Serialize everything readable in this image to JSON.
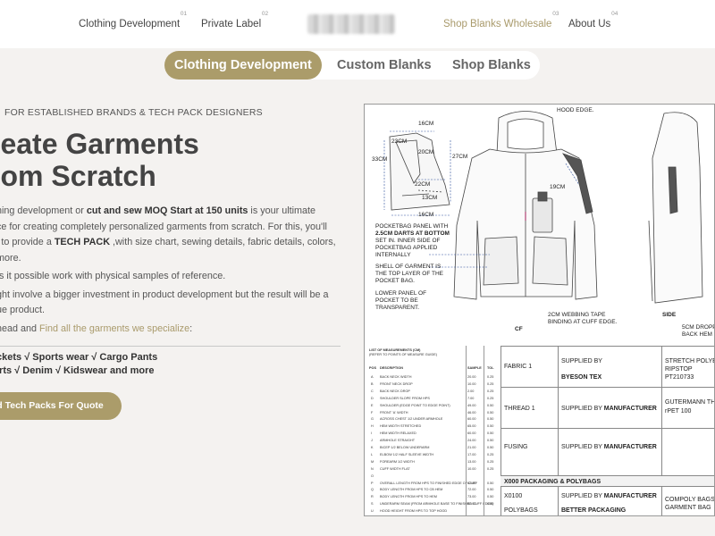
{
  "nav": {
    "items": [
      {
        "label": "Clothing Development",
        "num": "01"
      },
      {
        "label": "Private Label",
        "num": "02"
      },
      {
        "label": "Shop Blanks Wholesale",
        "num": "03"
      },
      {
        "label": "About Us",
        "num": "04"
      }
    ]
  },
  "tabs": [
    "Clothing Development",
    "Custom Blanks",
    "Shop Blanks"
  ],
  "hero": {
    "eyebrow": "FOR ESTABLISHED BRANDS & TECH PACK DESIGNERS",
    "headline_1": "reate Garments",
    "headline_2": "rom Scratch",
    "para1_a": "hing development or ",
    "para1_b": "cut and sew MOQ Start at 150 units",
    "para1_c": " is your ultimate",
    "para1_d": "ce for creating completely personalized garments from scratch. For this, you'll",
    "para1_e": "l to provide a ",
    "para1_f": "TECH PACK",
    "para1_g": " ,with size chart, sewing details, fabric details, colors,",
    "para1_h": "more.",
    "para2": "Is it possible work with physical samples of reference.",
    "para3_a": "ght involve a bigger investment in product development but the result will be a",
    "para3_b": "ue product.",
    "lead_a": "head and ",
    "lead_link": "Find all the garments we specialize",
    "lead_b": ":",
    "garments_1": "ckets √ Sports wear √ Cargo Pants",
    "garments_2": "irts  √ Denim  √ Kidswear and more",
    "cta": "d Tech Packs For Quote"
  },
  "techpack": {
    "dims": [
      "16CM",
      "23CM",
      "20CM",
      "33CM",
      "27CM",
      "22CM",
      "13CM",
      "16CM",
      "19CM"
    ],
    "hood_note": "HOOD EDGE.",
    "pocket_note": [
      "POCKETBAG PANEL WITH",
      "2.5CM DARTS AT BOTTOM",
      "SET IN. INNER SIDE OF",
      "POCKETBAG APPLIED",
      "INTERNALLY"
    ],
    "shell_note": [
      "SHELL OF GARMENT IS",
      "THE TOP LAYER OF THE",
      "POCKET BAG."
    ],
    "lower_note": [
      "LOWER PANEL OF",
      "POCKET TO BE",
      "TRANSPARENT."
    ],
    "webbing_note": [
      "2CM WEBBING TAPE",
      "BINDING AT CUFF EDGE."
    ],
    "cf_label": "CF",
    "side_label": "SIDE",
    "hem_note": [
      "5CM DROPPED",
      "BACK HEM"
    ],
    "meas_title": "LIST OF MEASUREMENTS (CM)",
    "meas_sub": "(REFER TO POINTS OF MEASURE GUIDE)",
    "meas_cols": [
      "POS",
      "DESCRIPTION",
      "SAMPLE",
      "TOL"
    ],
    "meas_rows": [
      {
        "k": "A",
        "d": "BACK NECK WIDTH",
        "v": "20.00",
        "t": "0.25"
      },
      {
        "k": "B",
        "d": "FRONT NECK DROP",
        "v": "10.00",
        "t": "0.25"
      },
      {
        "k": "C",
        "d": "BACK NECK DROP",
        "v": "2.00",
        "t": "0.25"
      },
      {
        "k": "D",
        "d": "SHOULDER SLOPE FROM HPS",
        "v": "7.00",
        "t": "0.25"
      },
      {
        "k": "E",
        "d": "SHOULDER (EDGE POINT TO EDGE POINT)",
        "v": "49.00",
        "t": "0.50"
      },
      {
        "k": "F",
        "d": "FRONT 'A' WIDTH",
        "v": "46.00",
        "t": "0.50"
      },
      {
        "k": "G",
        "d": "ACROSS CHEST 1/2 UNDER ARMHOLE",
        "v": "60.00",
        "t": "0.50"
      },
      {
        "k": "H",
        "d": "HEM WIDTH STRETCHED",
        "v": "65.00",
        "t": "0.50"
      },
      {
        "k": "I",
        "d": "HEM WIDTH RELAXED",
        "v": "60.00",
        "t": "0.50"
      },
      {
        "k": "J",
        "d": "ARMHOLE STRAIGHT",
        "v": "24.00",
        "t": "0.50"
      },
      {
        "k": "K",
        "d": "BICEP 1/2 BELOW UNDERARM",
        "v": "21.00",
        "t": "0.50"
      },
      {
        "k": "L",
        "d": "ELBOW 1/2 HALF SLEEVE WIDTH",
        "v": "17.00",
        "t": "0.25"
      },
      {
        "k": "M",
        "d": "FOREARM 1/2 WIDTH",
        "v": "13.00",
        "t": "0.25"
      },
      {
        "k": "N",
        "d": "CUFF WIDTH FLAT",
        "v": "10.00",
        "t": "0.25"
      },
      {
        "k": "O",
        "d": "",
        "v": "",
        "t": ""
      },
      {
        "k": "P",
        "d": "OVERALL LENGTH FROM HPS TO FINISHED EDGE OF CUFF",
        "v": "82.00",
        "t": "0.50"
      },
      {
        "k": "Q",
        "d": "BODY LENGTH FROM HPS TO CB HEM",
        "v": "72.00",
        "t": "0.50"
      },
      {
        "k": "R",
        "d": "BODY LENGTH FROM HPS TO HEM",
        "v": "73.00",
        "t": "0.50"
      },
      {
        "k": "S",
        "d": "UNDERARM SEAM (FROM ARMHOLE BASE TO FINISHED CUFF EDGE)",
        "v": "52.00",
        "t": "0.50"
      },
      {
        "k": "U",
        "d": "HOOD HEIGHT FROM HPS TO TOP HOOD",
        "v": "",
        "t": ""
      }
    ],
    "fabric_rows": [
      {
        "a": "FABRIC 1",
        "b1": "SUPPLIED BY",
        "b2": "BYESON TEX",
        "c": [
          "STRETCH POLYE",
          "RIPSTOP",
          "PT210733"
        ]
      },
      {
        "a": "THREAD 1",
        "b1": "SUPPLIED BY MANUFACTURER",
        "b2": "",
        "c": [
          "GUTERMANN TH",
          "rPET 100"
        ]
      },
      {
        "a": "FUSING",
        "b1": "SUPPLIED BY MANUFACTURER",
        "b2": "",
        "c": []
      },
      {
        "a": "X000 PACKAGING & POLYBAGS",
        "b1": "",
        "b2": "",
        "c": []
      },
      {
        "a": "X0100",
        "a2": "POLYBAGS",
        "b1": "SUPPLIED BY MANUFACTURER",
        "b2": "BETTER PACKAGING",
        "c": [
          "COMPOLY BAGS",
          "GARMENT BAG"
        ]
      }
    ]
  },
  "colors": {
    "accent": "#ab9c6a",
    "nav_active": "#a99a6b",
    "background": "#f4f2f0"
  }
}
